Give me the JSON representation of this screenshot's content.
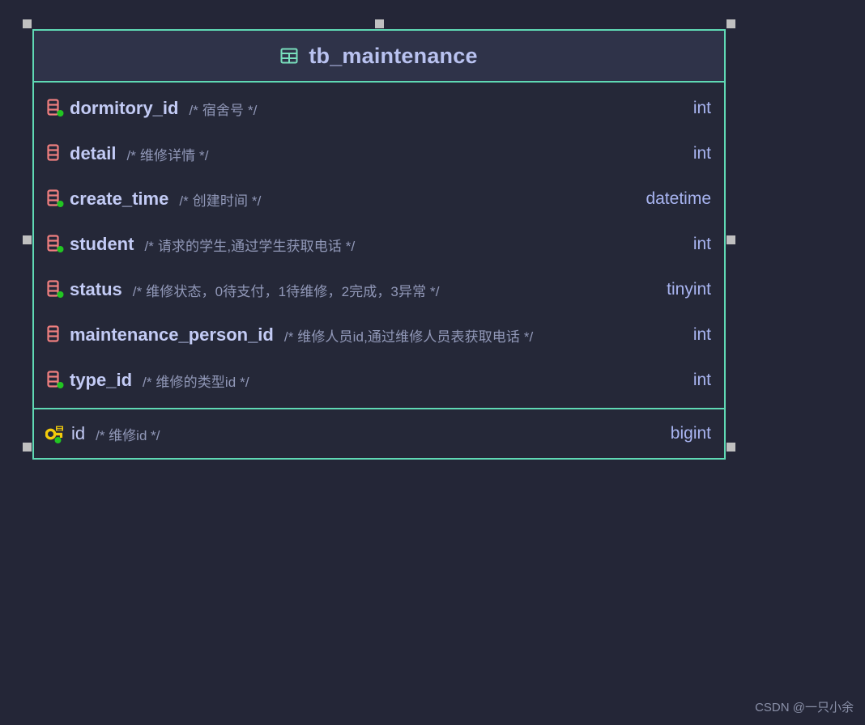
{
  "canvas": {
    "background_color": "#242637",
    "selection": {
      "handle_color": "#c0c0c0",
      "handle_count": 8,
      "handles": [
        "top-left",
        "top-center",
        "top-right",
        "middle-left",
        "middle-right",
        "bottom-left",
        "bottom-center",
        "bottom-right"
      ]
    }
  },
  "entity": {
    "accent_color": "#5fd9b4",
    "header": {
      "icon": "table-grid-icon",
      "title": "tb_maintenance",
      "background_color": "#2f3349",
      "title_color": "#b9c2f0"
    },
    "fields": [
      {
        "icon": "column-icon",
        "has_marker": true,
        "marker_color": "#22c522",
        "name": "dormitory_id",
        "comment": "/* 宿舍号 */",
        "type": "int"
      },
      {
        "icon": "column-icon",
        "has_marker": false,
        "marker_color": "#22c522",
        "name": "detail",
        "comment": "/* 维修详情 */",
        "type": "int"
      },
      {
        "icon": "column-icon",
        "has_marker": true,
        "marker_color": "#22c522",
        "name": "create_time",
        "comment": "/* 创建时间 */",
        "type": "datetime"
      },
      {
        "icon": "column-icon",
        "has_marker": true,
        "marker_color": "#22c522",
        "name": "student",
        "comment": "/* 请求的学生,通过学生获取电话 */",
        "type": "int"
      },
      {
        "icon": "column-icon",
        "has_marker": true,
        "marker_color": "#22c522",
        "name": "status",
        "comment": "/* 维修状态，0待支付，1待维修，2完成，3异常 */",
        "type": "tinyint"
      },
      {
        "icon": "column-icon",
        "has_marker": false,
        "marker_color": "#22c522",
        "name": "maintenance_person_id",
        "comment": "/* 维修人员id,通过维修人员表获取电话 */",
        "type": "int"
      },
      {
        "icon": "column-icon",
        "has_marker": true,
        "marker_color": "#22c522",
        "name": "type_id",
        "comment": "/* 维修的类型id */",
        "type": "int"
      }
    ],
    "primary_key": {
      "icon": "primary-key-icon",
      "has_marker": true,
      "marker_color": "#22c522",
      "name": "id",
      "comment": "/* 维修id */",
      "type": "bigint"
    }
  },
  "watermark": {
    "text": "CSDN @一只小余"
  }
}
